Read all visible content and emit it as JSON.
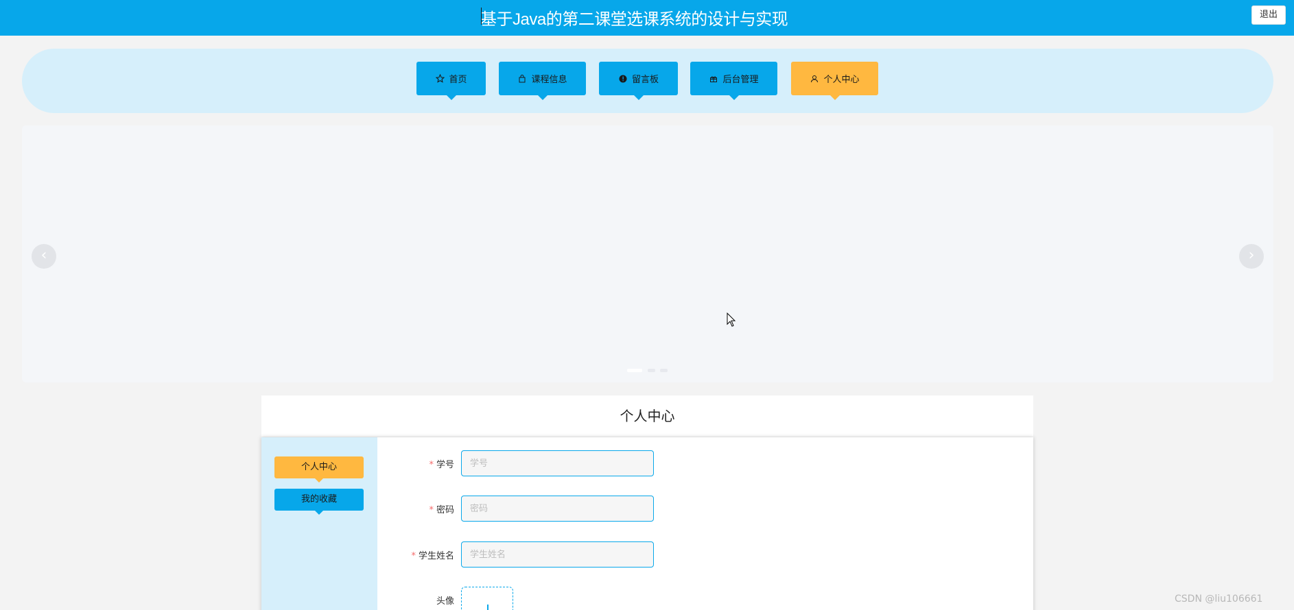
{
  "header": {
    "title": "基于Java的第二课堂选课系统的设计与实现",
    "logout_label": "退出"
  },
  "nav": {
    "items": [
      {
        "label": "首页",
        "icon": "star-icon"
      },
      {
        "label": "课程信息",
        "icon": "bag-icon"
      },
      {
        "label": "留言板",
        "icon": "alert-icon"
      },
      {
        "label": "后台管理",
        "icon": "gift-icon"
      },
      {
        "label": "个人中心",
        "icon": "user-icon",
        "active": true
      }
    ]
  },
  "carousel": {
    "prev_label": "‹",
    "next_label": "›",
    "slide_count": 3,
    "active_slide": 1
  },
  "personal_center": {
    "title": "个人中心",
    "sidebar": [
      {
        "label": "个人中心",
        "active": true
      },
      {
        "label": "我的收藏",
        "active": false
      }
    ],
    "form": {
      "student_id": {
        "label": "学号",
        "placeholder": "学号",
        "required": true,
        "value": ""
      },
      "password": {
        "label": "密码",
        "placeholder": "密码",
        "required": true,
        "value": ""
      },
      "student_name": {
        "label": "学生姓名",
        "placeholder": "学生姓名",
        "required": true,
        "value": ""
      },
      "avatar": {
        "label": "头像",
        "required": false
      }
    },
    "required_mark": "*"
  },
  "watermark": "CSDN @liu106661",
  "colors": {
    "primary": "#07a7ea",
    "accent": "#ffb840",
    "nav_bg": "#d6effb"
  }
}
